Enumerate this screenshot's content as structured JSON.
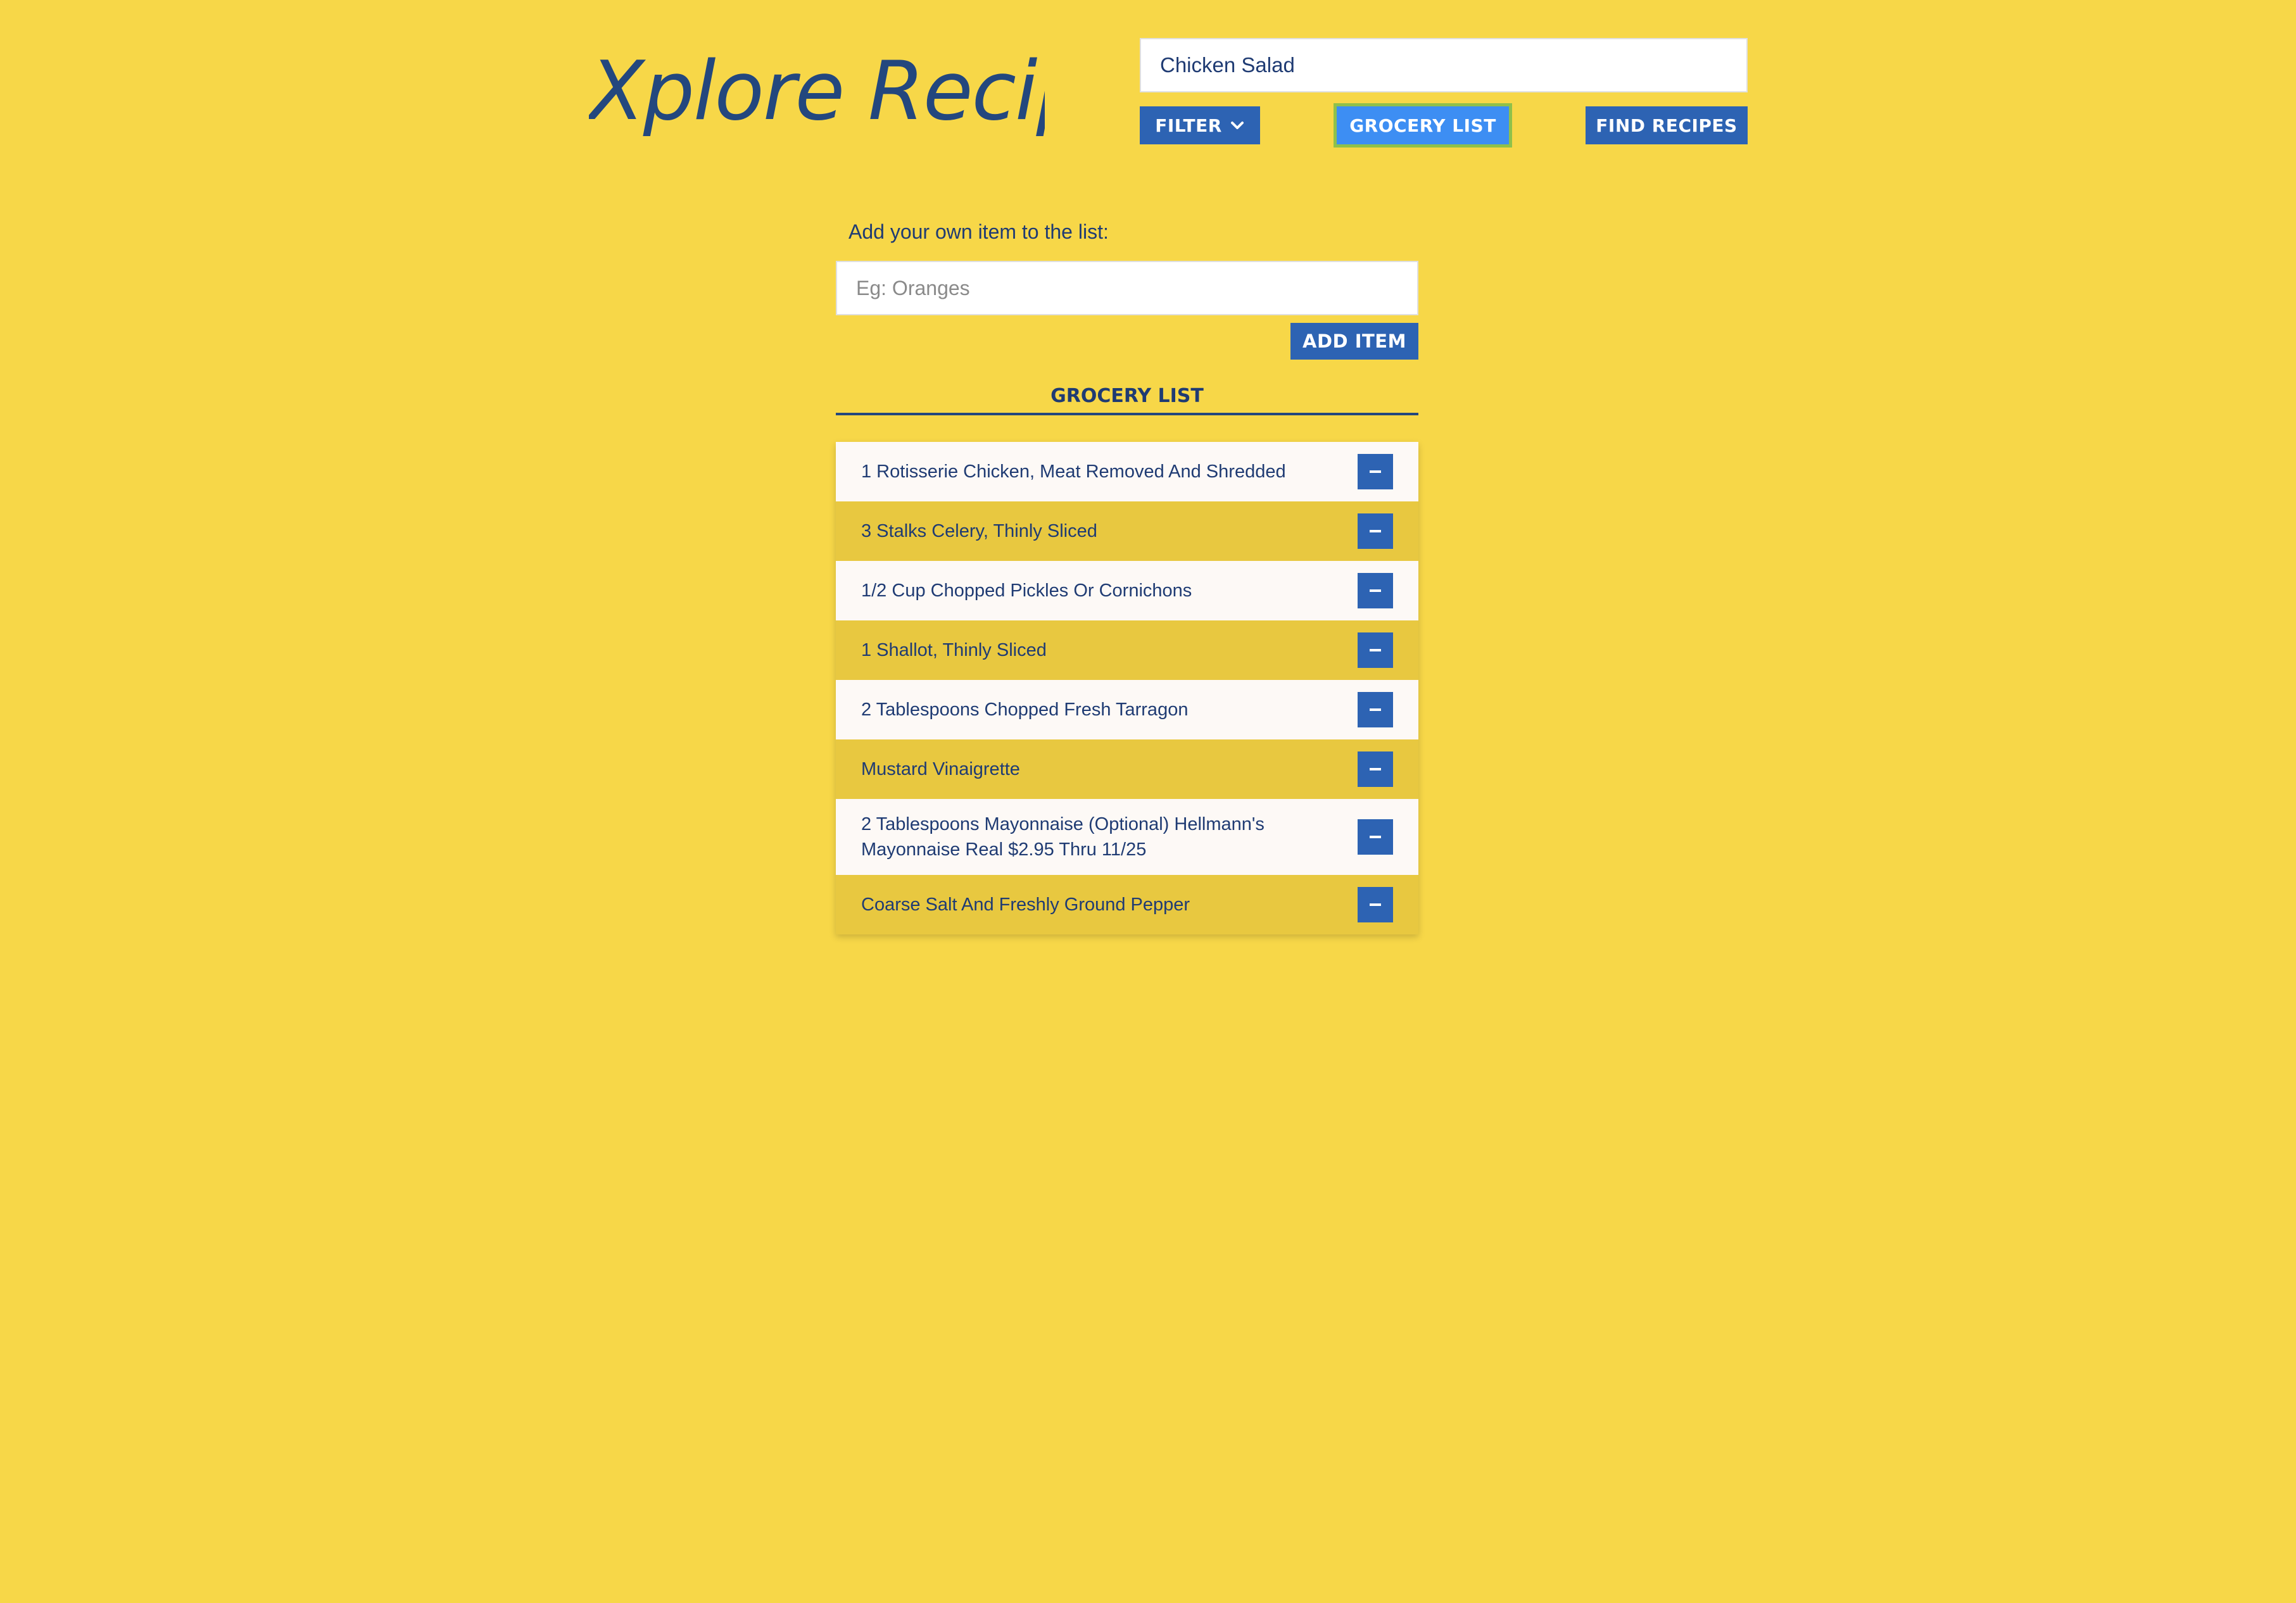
{
  "header": {
    "logo_text": "Xplore Recipes",
    "search_value": "Chicken Salad",
    "filter_label": "FILTER",
    "grocery_label": "GROCERY LIST",
    "find_label": "FIND RECIPES"
  },
  "add_item": {
    "label": "Add your own item to the list:",
    "placeholder": "Eg: Oranges",
    "button_label": "ADD ITEM"
  },
  "grocery": {
    "title": "GROCERY LIST",
    "items": [
      "1 Rotisserie Chicken, Meat Removed And Shredded",
      "3 Stalks Celery, Thinly Sliced",
      "1/2 Cup Chopped Pickles Or Cornichons",
      "1 Shallot, Thinly Sliced",
      "2 Tablespoons Chopped Fresh Tarragon",
      "Mustard Vinaigrette",
      "2 Tablespoons Mayonnaise (Optional) Hellmann's Mayonnaise Real $2.95 Thru 11/25",
      "Coarse Salt And Freshly Ground Pepper"
    ]
  },
  "colors": {
    "background": "#f7d748",
    "primary_button": "#2d63b3",
    "active_button": "#3d8ef3",
    "active_border": "#8fc14a",
    "text": "#1f3b73",
    "row_light": "#fdf9f6",
    "row_dark": "#e8c840"
  },
  "icons": {
    "filter": "chevron-down-icon",
    "remove": "minus-icon"
  }
}
